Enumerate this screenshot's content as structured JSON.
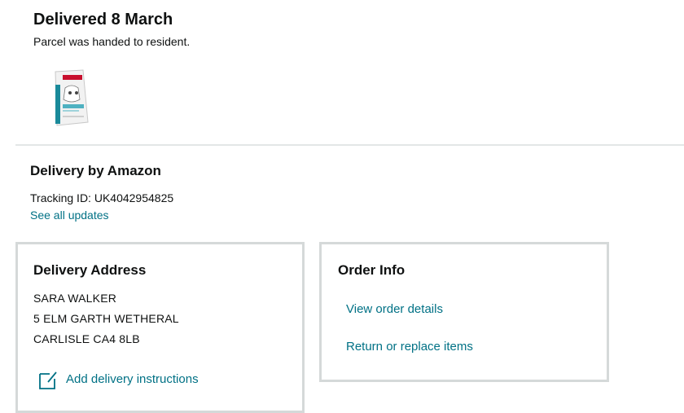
{
  "status": {
    "title": "Delivered 8 March",
    "subtitle": "Parcel was handed to resident."
  },
  "product": {
    "brand_text": "ROYAL CANIN",
    "colors": {
      "bag": "#f2f2f2",
      "accent": "#1a8a9a",
      "brand_red": "#c8102e"
    }
  },
  "delivery": {
    "title": "Delivery by Amazon",
    "tracking": "Tracking ID: UK4042954825",
    "see_all_updates": "See all updates"
  },
  "address": {
    "title": "Delivery Address",
    "lines": [
      "SARA WALKER",
      "5 ELM GARTH WETHERAL",
      "CARLISLE CA4 8LB"
    ],
    "instructions_link": "Add delivery instructions"
  },
  "order_info": {
    "title": "Order Info",
    "view_details": "View order details",
    "return_replace": "Return or replace items"
  },
  "theme": {
    "link": "#007185",
    "border": "#d5d9d9",
    "divider": "#e3e6e6"
  }
}
